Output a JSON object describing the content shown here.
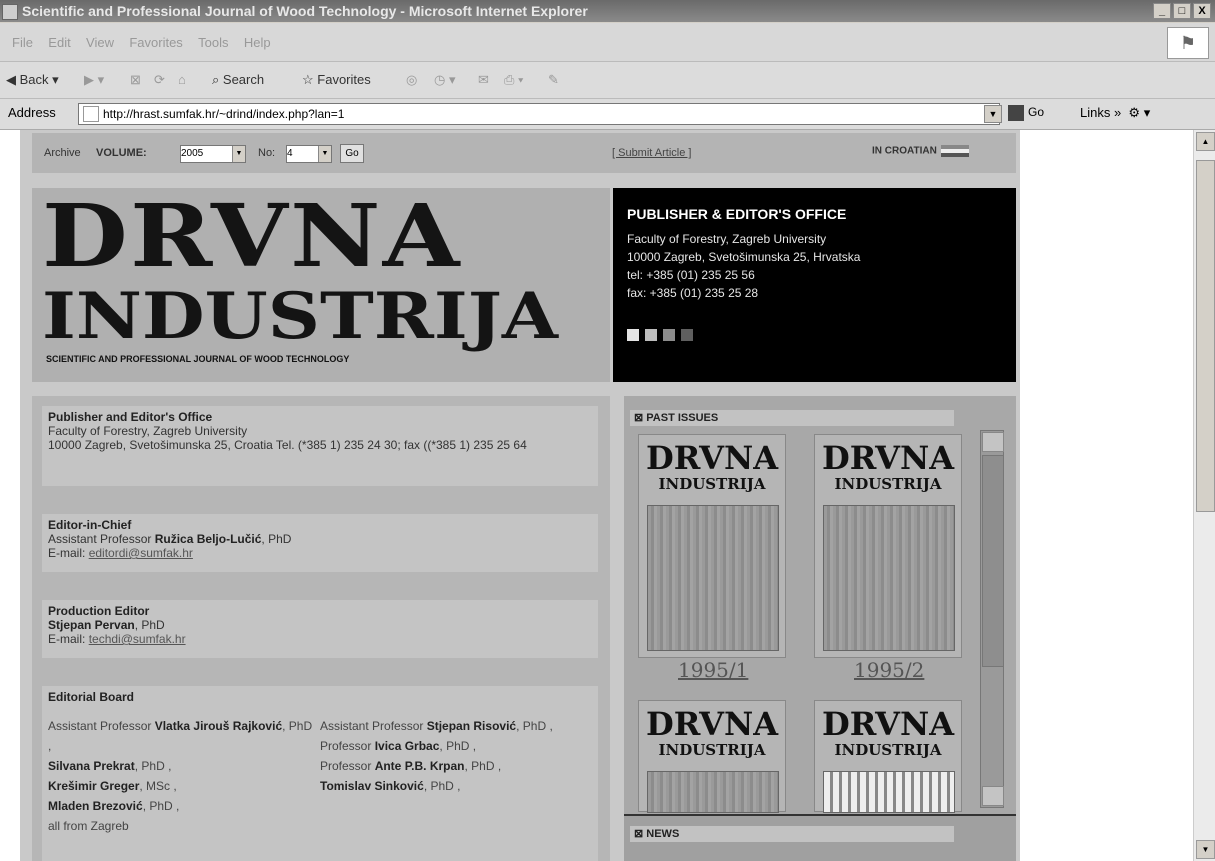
{
  "window": {
    "title": "Scientific and Professional Journal of Wood Technology - Microsoft Internet Explorer",
    "min": "_",
    "max": "□",
    "close": "X"
  },
  "menu": [
    "File",
    "Edit",
    "View",
    "Favorites",
    "Tools",
    "Help"
  ],
  "toolbar": {
    "back": "Back",
    "search": "Search",
    "favorites": "Favorites"
  },
  "address": {
    "label": "Address",
    "url": "http://hrast.sumfak.hr/~drind/index.php?lan=1",
    "go": "Go",
    "links": "Links"
  },
  "archive": {
    "label": "Archive",
    "volume_label": "VOLUME:",
    "volume_value": "2005",
    "no_label": "No:",
    "no_value": "4",
    "go": "Go",
    "submit": "[ Submit Article ]",
    "language": "IN CROATIAN"
  },
  "masthead": {
    "line1": "DRVNA",
    "line2": "INDUSTRIJA",
    "tagline": "SCIENTIFIC AND PROFESSIONAL JOURNAL OF WOOD TECHNOLOGY"
  },
  "office": {
    "heading": "PUBLISHER & EDITOR'S OFFICE",
    "lines": [
      "Faculty of Forestry, Zagreb University",
      "10000 Zagreb, Svetošimunska 25, Hrvatska",
      "tel: +385 (01) 235 25 56",
      "fax: +385 (01) 235 25 28"
    ],
    "squares": [
      "#e4e4e4",
      "#bdbdbd",
      "#8c8c8c",
      "#5f5f5f"
    ]
  },
  "publisher": {
    "title": "Publisher and Editor's Office",
    "line1": "Faculty of Forestry, Zagreb University",
    "line2": "10000 Zagreb, Svetošimunska 25, Croatia Tel. (*385 1) 235 24 30; fax ((*385 1) 235 25 64"
  },
  "editor_in_chief": {
    "title": "Editor-in-Chief",
    "role": "Assistant Professor",
    "name": "Ružica Beljo-Lučić",
    "suffix": ", PhD",
    "email_label": "E-mail:",
    "email": "editordi@sumfak.hr"
  },
  "production_editor": {
    "title": "Production Editor",
    "name": "Stjepan Pervan",
    "suffix": ", PhD",
    "email_label": "E-mail:",
    "email": "techdi@sumfak.hr"
  },
  "editorial_board": {
    "title": "Editorial Board",
    "left": [
      {
        "pre": "Assistant Professor ",
        "name": "Vlatka Jirouš Rajković",
        "post": ", PhD ,"
      },
      {
        "pre": "",
        "name": "Silvana Prekrat",
        "post": ", PhD ,"
      },
      {
        "pre": "",
        "name": "Krešimir Greger",
        "post": ", MSc ,"
      },
      {
        "pre": "",
        "name": "Mladen Brezović",
        "post": ", PhD ,"
      },
      {
        "pre": "all from Zagreb",
        "name": "",
        "post": ""
      }
    ],
    "right": [
      {
        "pre": "Assistant Professor ",
        "name": "Stjepan Risović",
        "post": ", PhD ,"
      },
      {
        "pre": "Professor ",
        "name": "Ivica Grbac",
        "post": ", PhD ,"
      },
      {
        "pre": "Professor ",
        "name": "Ante P.B. Krpan",
        "post": ", PhD ,"
      },
      {
        "pre": "",
        "name": "Tomislav Sinković",
        "post": ", PhD ,"
      }
    ]
  },
  "past_issues": {
    "heading": "PAST ISSUES",
    "covers": [
      {
        "title1": "DRVNA",
        "title2": "INDUSTRIJA",
        "label": "1995/1"
      },
      {
        "title1": "DRVNA",
        "title2": "INDUSTRIJA",
        "label": "1995/2"
      },
      {
        "title1": "DRVNA",
        "title2": "INDUSTRIJA",
        "label": ""
      },
      {
        "title1": "DRVNA",
        "title2": "INDUSTRIJA",
        "label": ""
      }
    ]
  },
  "news": {
    "heading": "NEWS"
  }
}
